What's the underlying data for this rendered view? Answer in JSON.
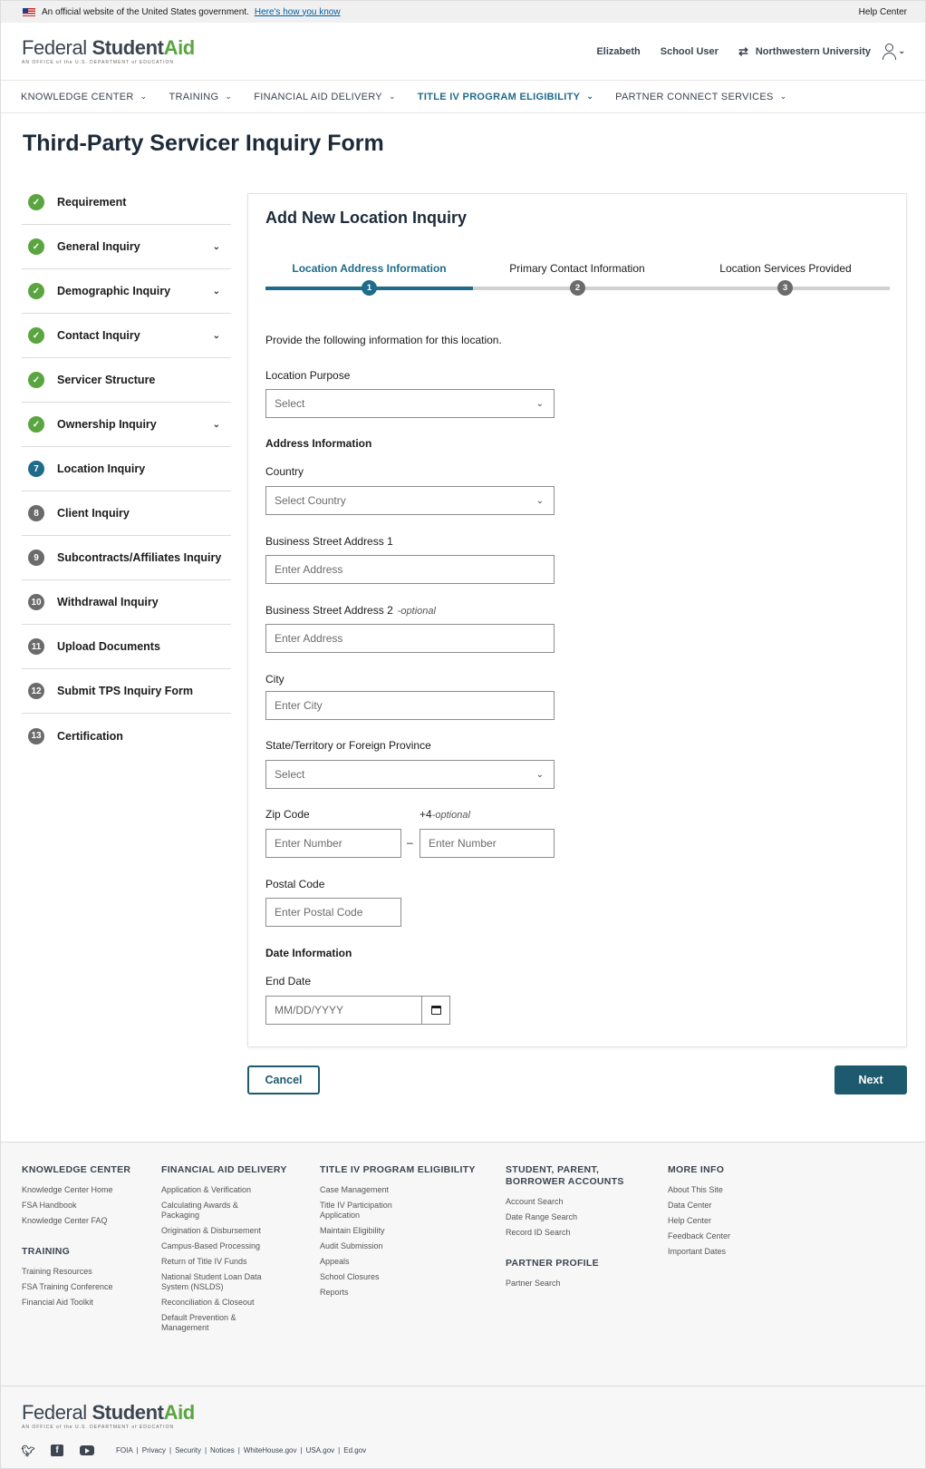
{
  "gov_banner": {
    "text": "An official website of the United States government.",
    "link": "Here's how you know",
    "help": "Help Center"
  },
  "header": {
    "logo_federal": "Federal ",
    "logo_student": "Student",
    "logo_aid": "Aid",
    "logo_tagline": "AN OFFICE of the U.S. DEPARTMENT of EDUCATION",
    "user_name": "Elizabeth",
    "user_role": "School User",
    "school": "Northwestern University"
  },
  "nav": [
    {
      "label": "KNOWLEDGE CENTER"
    },
    {
      "label": "TRAINING"
    },
    {
      "label": "FINANCIAL AID DELIVERY"
    },
    {
      "label": "TITLE IV PROGRAM ELIGIBILITY"
    },
    {
      "label": "PARTNER CONNECT SERVICES"
    }
  ],
  "page_title": "Third-Party Servicer Inquiry Form",
  "steps": [
    {
      "label": "Requirement",
      "badge": "✓",
      "state": "done",
      "expand": false
    },
    {
      "label": "General Inquiry",
      "badge": "✓",
      "state": "done",
      "expand": true
    },
    {
      "label": "Demographic Inquiry",
      "badge": "✓",
      "state": "done",
      "expand": true
    },
    {
      "label": "Contact Inquiry",
      "badge": "✓",
      "state": "done",
      "expand": true
    },
    {
      "label": "Servicer Structure",
      "badge": "✓",
      "state": "done",
      "expand": false
    },
    {
      "label": "Ownership Inquiry",
      "badge": "✓",
      "state": "done",
      "expand": true
    },
    {
      "label": "Location Inquiry",
      "badge": "7",
      "state": "current",
      "expand": false
    },
    {
      "label": "Client Inquiry",
      "badge": "8",
      "state": "todo",
      "expand": false
    },
    {
      "label": "Subcontracts/Affiliates Inquiry",
      "badge": "9",
      "state": "todo",
      "expand": false
    },
    {
      "label": "Withdrawal Inquiry",
      "badge": "10",
      "state": "todo",
      "expand": false
    },
    {
      "label": "Upload Documents",
      "badge": "11",
      "state": "todo",
      "expand": false
    },
    {
      "label": "Submit TPS Inquiry Form",
      "badge": "12",
      "state": "todo",
      "expand": false
    },
    {
      "label": "Certification",
      "badge": "13",
      "state": "todo",
      "expand": false
    }
  ],
  "form": {
    "title": "Add New Location Inquiry",
    "progress": [
      {
        "label": "Location Address Information",
        "num": "1"
      },
      {
        "label": "Primary Contact Information",
        "num": "2"
      },
      {
        "label": "Location Services Provided",
        "num": "3"
      }
    ],
    "intro": "Provide the following information for this location.",
    "location_purpose_label": "Location Purpose",
    "location_purpose_value": "Select",
    "address_section": "Address Information",
    "country_label": "Country",
    "country_value": "Select Country",
    "street1_label": "Business Street Address 1",
    "street1_placeholder": "Enter Address",
    "street2_label": "Business Street Address 2",
    "optional": "-optional",
    "street2_placeholder": "Enter Address",
    "city_label": "City",
    "city_placeholder": "Enter City",
    "state_label": "State/Territory or Foreign Province",
    "state_value": "Select",
    "zip_label": "Zip Code",
    "plus4_label": "+4",
    "zip_placeholder": "Enter Number",
    "plus4_placeholder": "Enter Number",
    "zip_dash": "–",
    "postal_label": "Postal Code",
    "postal_placeholder": "Enter Postal Code",
    "date_section": "Date Information",
    "end_date_label": "End Date",
    "end_date_placeholder": "MM/DD/YYYY"
  },
  "buttons": {
    "cancel": "Cancel",
    "next": "Next"
  },
  "footer": {
    "knowledge_center": {
      "heading": "KNOWLEDGE CENTER",
      "links": [
        "Knowledge Center Home",
        "FSA Handbook",
        "Knowledge Center FAQ"
      ]
    },
    "training": {
      "heading": "TRAINING",
      "links": [
        "Training Resources",
        "FSA Training Conference",
        "Financial Aid Toolkit"
      ]
    },
    "financial_aid_delivery": {
      "heading": "FINANCIAL AID DELIVERY",
      "links": [
        "Application & Verification",
        "Calculating Awards & Packaging",
        "Origination & Disbursement",
        "Campus-Based Processing",
        "Return of Title IV Funds",
        "National Student Loan Data System (NSLDS)",
        "Reconciliation & Closeout",
        "Default Prevention & Management"
      ]
    },
    "title_iv": {
      "heading": "TITLE IV PROGRAM ELIGIBILITY",
      "links": [
        "Case Management",
        "Title IV Participation Application",
        "Maintain Eligibility",
        "Audit Submission",
        "Appeals",
        "School Closures",
        "Reports"
      ]
    },
    "accounts": {
      "heading": "STUDENT, PARENT, BORROWER ACCOUNTS",
      "links": [
        "Account Search",
        "Date Range Search",
        "Record ID Search"
      ]
    },
    "partner_profile": {
      "heading": "PARTNER PROFILE",
      "links": [
        "Partner Search"
      ]
    },
    "more_info": {
      "heading": "MORE INFO",
      "links": [
        "About This Site",
        "Data Center",
        "Help Center",
        "Feedback Center",
        "Important Dates"
      ]
    },
    "bottom_links": [
      "FOIA",
      "Privacy",
      "Security",
      "Notices",
      "WhiteHouse.gov",
      "USA.gov",
      "Ed.gov"
    ]
  }
}
